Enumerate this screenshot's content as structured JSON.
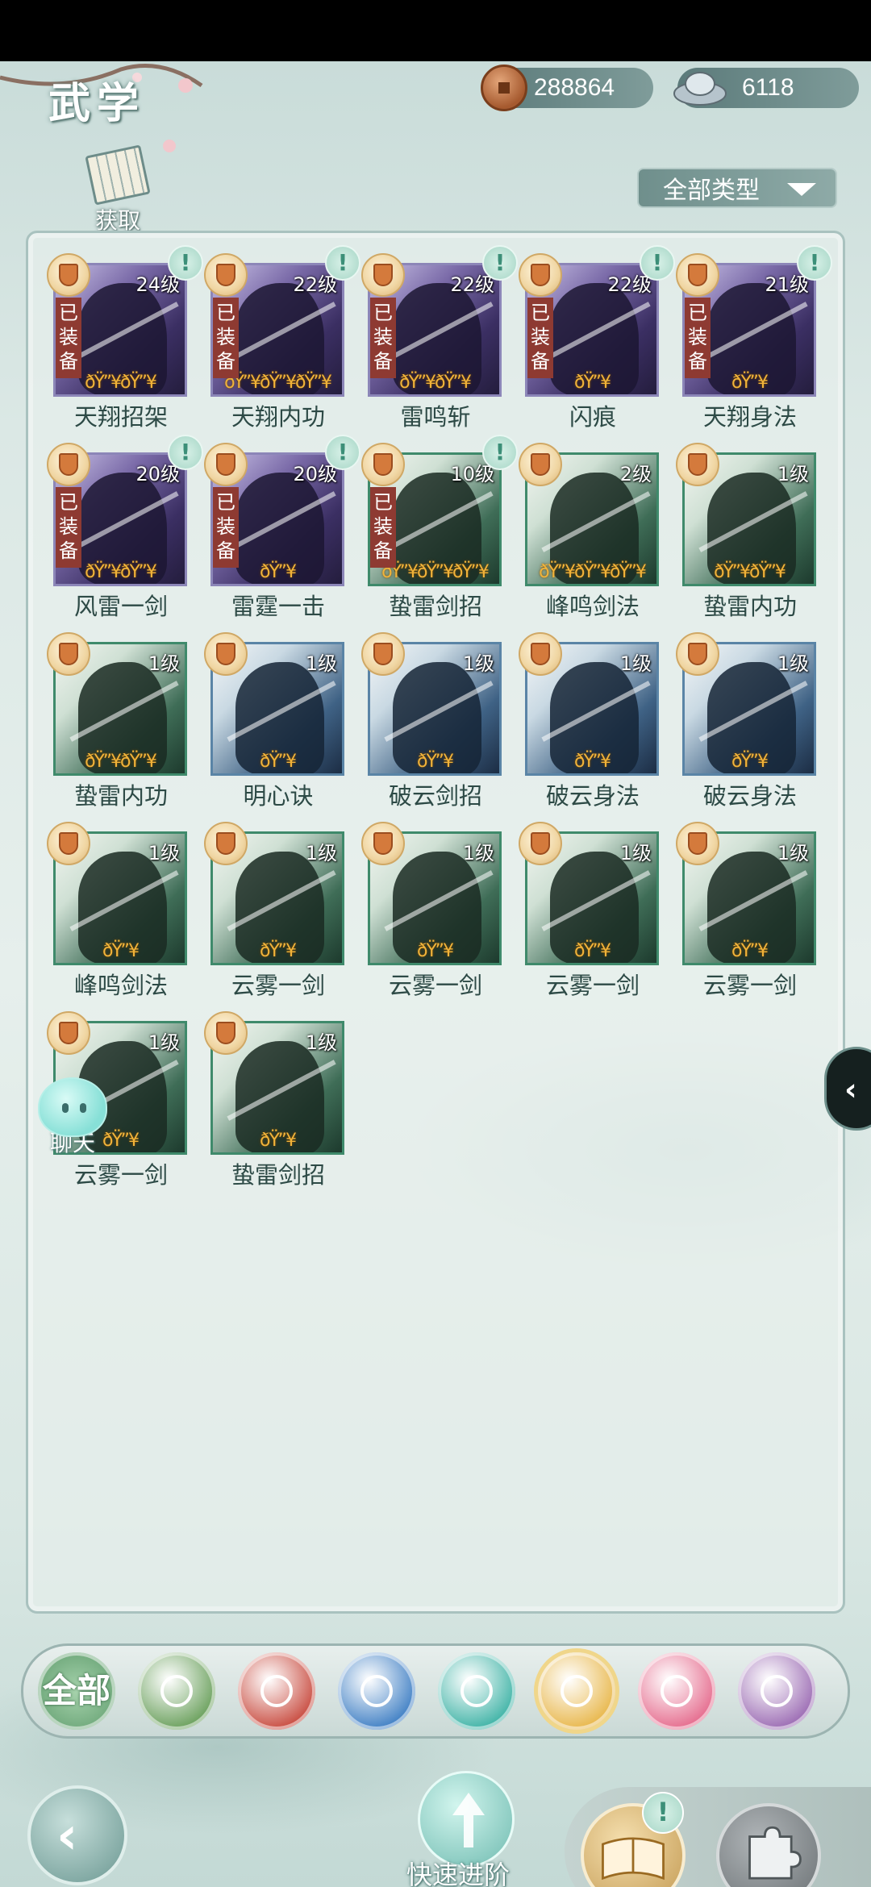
{
  "header": {
    "title": "武学",
    "copper": "288864",
    "silver": "6118",
    "obtain_label": "获取",
    "filter_label": "全部类型"
  },
  "skills": [
    {
      "name": "天翔招架",
      "level": "24级",
      "theme": "purple",
      "equipped_label": "已装备",
      "flames": "ðŸ”¥ðŸ”¥",
      "alert": "!"
    },
    {
      "name": "天翔内功",
      "level": "22级",
      "theme": "purple",
      "equipped_label": "已装备",
      "flames": "ðŸ”¥ðŸ”¥ðŸ”¥",
      "alert": "!"
    },
    {
      "name": "雷鸣斩",
      "level": "22级",
      "theme": "purple",
      "equipped_label": "已装备",
      "flames": "ðŸ”¥ðŸ”¥",
      "alert": "!"
    },
    {
      "name": "闪痕",
      "level": "22级",
      "theme": "purple",
      "equipped_label": "已装备",
      "flames": "ðŸ”¥",
      "alert": "!"
    },
    {
      "name": "天翔身法",
      "level": "21级",
      "theme": "purple",
      "equipped_label": "已装备",
      "flames": "ðŸ”¥",
      "alert": "!"
    },
    {
      "name": "风雷一剑",
      "level": "20级",
      "theme": "purple",
      "equipped_label": "已装备",
      "flames": "ðŸ”¥ðŸ”¥",
      "alert": "!"
    },
    {
      "name": "雷霆一击",
      "level": "20级",
      "theme": "purple",
      "equipped_label": "已装备",
      "flames": "ðŸ”¥",
      "alert": "!"
    },
    {
      "name": "蛰雷剑招",
      "level": "10级",
      "theme": "green",
      "equipped_label": "已装备",
      "flames": "ðŸ”¥ðŸ”¥ðŸ”¥",
      "alert": "!"
    },
    {
      "name": "峰鸣剑法",
      "level": "2级",
      "theme": "green",
      "equipped_label": "",
      "flames": "ðŸ”¥ðŸ”¥ðŸ”¥",
      "alert": ""
    },
    {
      "name": "蛰雷内功",
      "level": "1级",
      "theme": "green",
      "equipped_label": "",
      "flames": "ðŸ”¥ðŸ”¥",
      "alert": ""
    },
    {
      "name": "蛰雷内功",
      "level": "1级",
      "theme": "green",
      "equipped_label": "",
      "flames": "ðŸ”¥ðŸ”¥",
      "alert": ""
    },
    {
      "name": "明心诀",
      "level": "1级",
      "theme": "blue",
      "equipped_label": "",
      "flames": "ðŸ”¥",
      "alert": ""
    },
    {
      "name": "破云剑招",
      "level": "1级",
      "theme": "blue",
      "equipped_label": "",
      "flames": "ðŸ”¥",
      "alert": ""
    },
    {
      "name": "破云身法",
      "level": "1级",
      "theme": "blue",
      "equipped_label": "",
      "flames": "ðŸ”¥",
      "alert": ""
    },
    {
      "name": "破云身法",
      "level": "1级",
      "theme": "blue",
      "equipped_label": "",
      "flames": "ðŸ”¥",
      "alert": ""
    },
    {
      "name": "峰鸣剑法",
      "level": "1级",
      "theme": "green",
      "equipped_label": "",
      "flames": "ðŸ”¥",
      "alert": ""
    },
    {
      "name": "云雾一剑",
      "level": "1级",
      "theme": "green",
      "equipped_label": "",
      "flames": "ðŸ”¥",
      "alert": ""
    },
    {
      "name": "云雾一剑",
      "level": "1级",
      "theme": "green",
      "equipped_label": "",
      "flames": "ðŸ”¥",
      "alert": ""
    },
    {
      "name": "云雾一剑",
      "level": "1级",
      "theme": "green",
      "equipped_label": "",
      "flames": "ðŸ”¥",
      "alert": ""
    },
    {
      "name": "云雾一剑",
      "level": "1级",
      "theme": "green",
      "equipped_label": "",
      "flames": "ðŸ”¥",
      "alert": ""
    },
    {
      "name": "云雾一剑",
      "level": "1级",
      "theme": "green",
      "equipped_label": "",
      "flames": "ðŸ”¥",
      "alert": ""
    },
    {
      "name": "蛰雷剑招",
      "level": "1级",
      "theme": "green",
      "equipped_label": "",
      "flames": "ðŸ”¥",
      "alert": ""
    }
  ],
  "chat_label": "聊天",
  "categories": [
    {
      "label": "全部",
      "color": "#6fae7c"
    },
    {
      "label": "",
      "color": "#6aa05c",
      "icon": "sword-fan-icon"
    },
    {
      "label": "",
      "color": "#c84b3f",
      "icon": "flame-icon"
    },
    {
      "label": "",
      "color": "#3f7fc4",
      "icon": "wave-icon"
    },
    {
      "label": "",
      "color": "#3fb3a6",
      "icon": "butterfly-icon"
    },
    {
      "label": "",
      "color": "#e8b74b",
      "icon": "shield-icon"
    },
    {
      "label": "",
      "color": "#e56b8d",
      "icon": "moon-icon"
    },
    {
      "label": "",
      "color": "#9b6bb3",
      "icon": "flower-icon"
    }
  ],
  "bottom": {
    "quick_label": "快速进阶",
    "overview_label": "总览",
    "fragment_label": "碎片",
    "overview_alert": "!"
  }
}
